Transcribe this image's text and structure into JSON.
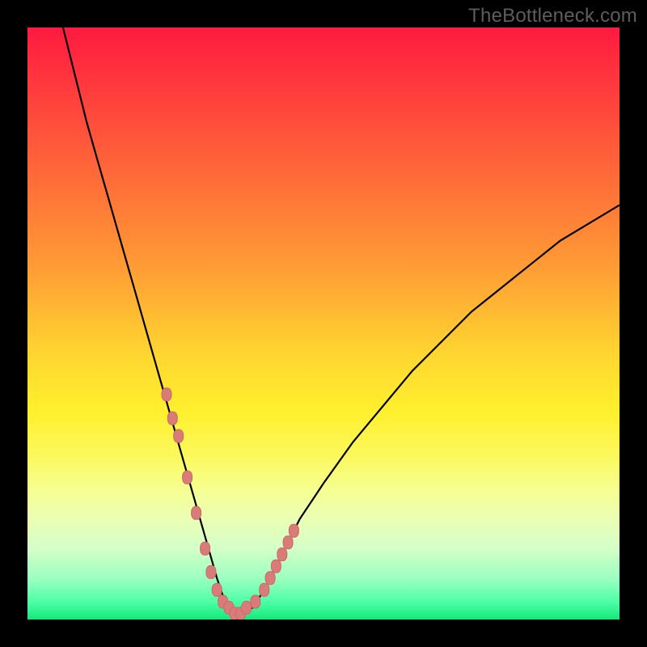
{
  "watermark": "TheBottleneck.com",
  "colors": {
    "frame": "#000000",
    "curve_stroke": "#000000",
    "marker_fill": "#d97b78",
    "marker_stroke": "#c96c69"
  },
  "chart_data": {
    "type": "line",
    "title": "",
    "xlabel": "",
    "ylabel": "",
    "xlim": [
      0,
      100
    ],
    "ylim": [
      0,
      100
    ],
    "grid": false,
    "legend": false,
    "annotations": [
      "TheBottleneck.com"
    ],
    "series": [
      {
        "name": "bottleneck-curve",
        "x": [
          6,
          8,
          10,
          12,
          14,
          16,
          18,
          20,
          22,
          24,
          26,
          28,
          30,
          32,
          33,
          34,
          35,
          36,
          38,
          40,
          42,
          44,
          46,
          48,
          50,
          55,
          60,
          65,
          70,
          75,
          80,
          85,
          90,
          95,
          100
        ],
        "y": [
          100,
          92,
          84,
          77,
          70,
          63,
          56,
          49,
          42,
          35,
          28,
          21,
          14,
          7,
          4,
          2,
          1,
          1,
          2,
          5,
          9,
          13,
          17,
          20,
          23,
          30,
          36,
          42,
          47,
          52,
          56,
          60,
          64,
          67,
          70
        ]
      }
    ],
    "markers": {
      "name": "highlight-points",
      "x": [
        23.5,
        24.5,
        25.5,
        27.0,
        28.5,
        30.0,
        31.0,
        32.0,
        33.0,
        34.0,
        35.0,
        36.0,
        37.0,
        38.5,
        40.0,
        41.0,
        42.0,
        43.0,
        44.0,
        45.0
      ],
      "y": [
        38,
        34,
        31,
        24,
        18,
        12,
        8,
        5,
        3,
        2,
        1,
        1,
        2,
        3,
        5,
        7,
        9,
        11,
        13,
        15
      ]
    }
  }
}
